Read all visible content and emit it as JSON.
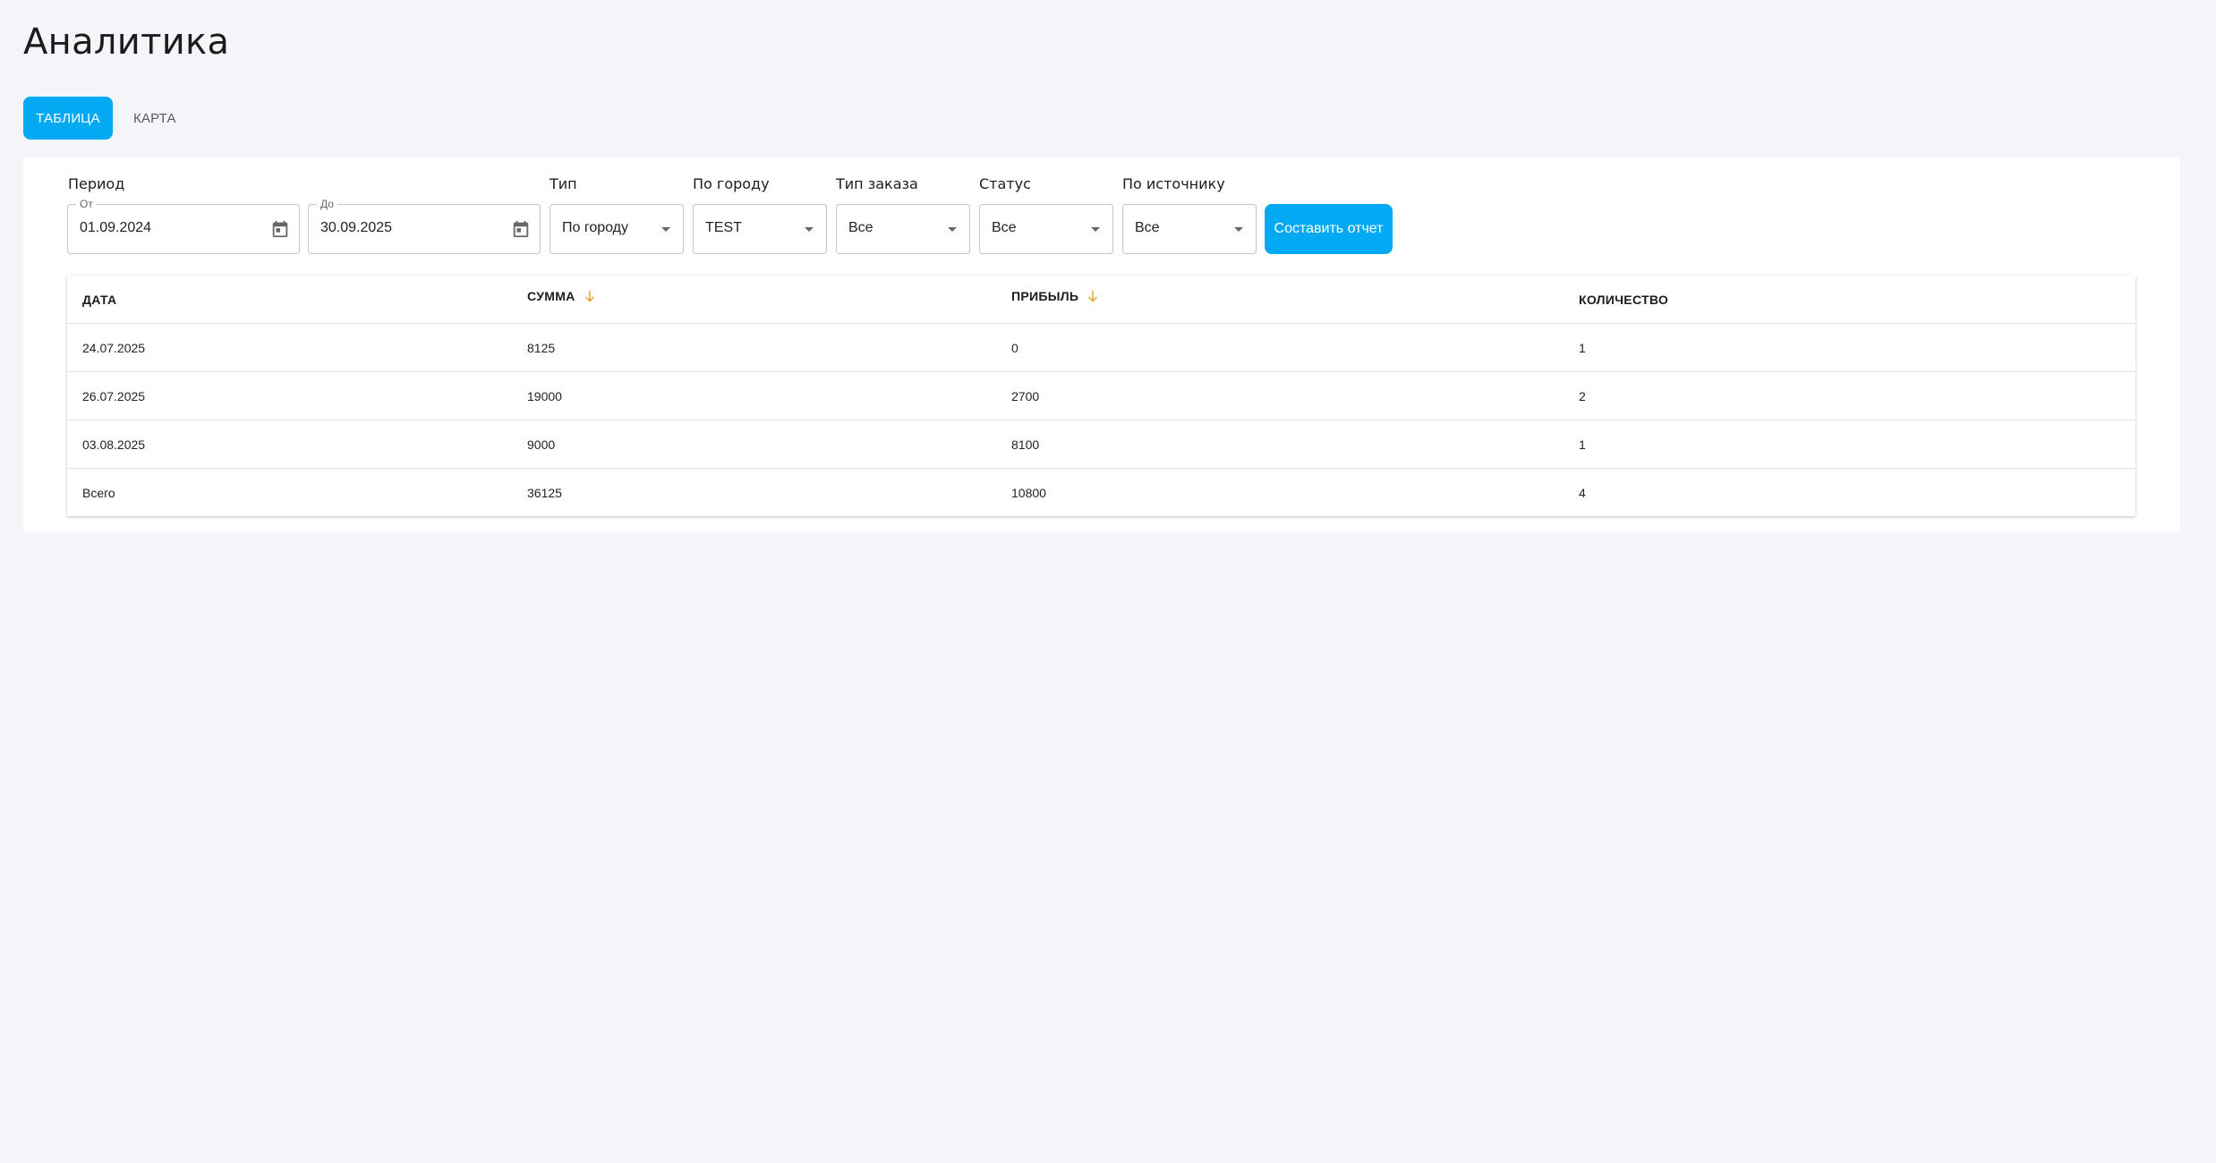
{
  "page": {
    "title": "Аналитика"
  },
  "tabs": [
    {
      "label": "ТАБЛИЦА",
      "active": true
    },
    {
      "label": "КАРТА",
      "active": false
    }
  ],
  "filters": {
    "period_label": "Период",
    "from": {
      "legend": "От",
      "value": "01.09.2024"
    },
    "to": {
      "legend": "До",
      "value": "30.09.2025"
    },
    "type": {
      "label": "Тип",
      "value": "По городу"
    },
    "city": {
      "label": "По городу",
      "value": "TEST"
    },
    "order_type": {
      "label": "Тип заказа",
      "value": "Все"
    },
    "status": {
      "label": "Статус",
      "value": "Все"
    },
    "source": {
      "label": "По источнику",
      "value": "Все"
    },
    "submit_label": "Составить отчет"
  },
  "table": {
    "columns": [
      "ДАТА",
      "СУММА",
      "ПРИБЫЛЬ",
      "КОЛИЧЕСТВО"
    ],
    "rows": [
      [
        "24.07.2025",
        "8125",
        "0",
        "1"
      ],
      [
        "26.07.2025",
        "19000",
        "2700",
        "2"
      ],
      [
        "03.08.2025",
        "9000",
        "8100",
        "1"
      ],
      [
        "Всего",
        "36125",
        "10800",
        "4"
      ]
    ]
  },
  "colors": {
    "accent": "#04a9f4",
    "background": "#f4f5f9",
    "sort_arrow": "#e0a020"
  },
  "icons": {
    "date": "calendar-icon",
    "select": "caret-down-icon",
    "sort": "arrow-down-icon"
  }
}
